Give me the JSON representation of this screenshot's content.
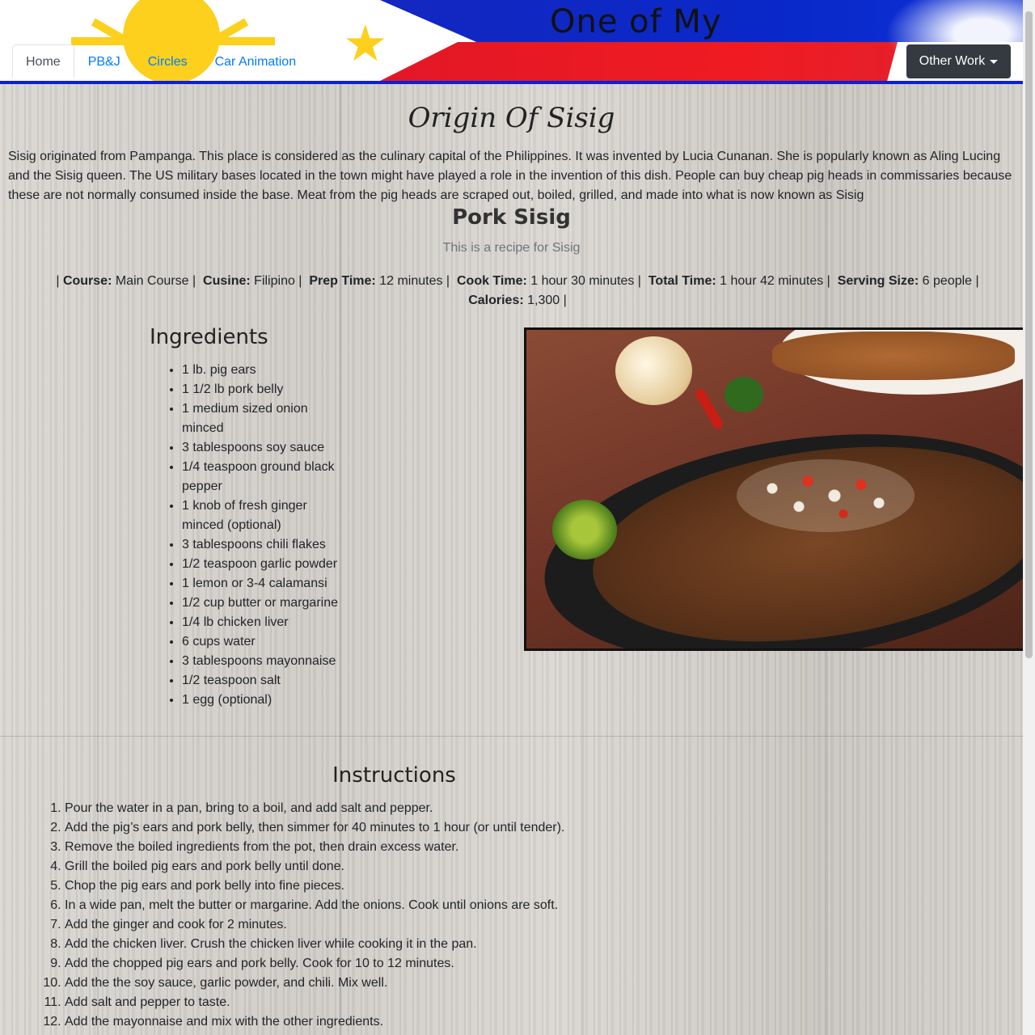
{
  "header": {
    "title": "One of My F",
    "nav_tabs": [
      {
        "label": "Home",
        "active": true
      },
      {
        "label": "PB&J",
        "active": false
      },
      {
        "label": "Circles",
        "active": false
      },
      {
        "label": "Car Animation",
        "active": false
      }
    ],
    "dropdown_label": "Other Work"
  },
  "origin": {
    "title": "Origin Of Sisig",
    "text": "Sisig originated from Pampanga. This place is considered as the culinary capital of the Philippines. It was invented by Lucia Cunanan. She is popularly known as Aling Lucing and the Sisig queen. The US military bases located in the town might have played a role in the invention of this dish. People can buy cheap pig heads in commissaries because these are not normally consumed inside the base. Meat from the pig heads are scraped out, boiled, grilled, and made into what is now known as Sisig"
  },
  "recipe": {
    "title": "Pork Sisig",
    "subtitle": "This is a recipe for Sisig",
    "meta": [
      {
        "label": "Course:",
        "value": "Main Course"
      },
      {
        "label": "Cusine:",
        "value": "Filipino"
      },
      {
        "label": "Prep Time:",
        "value": "12 minutes"
      },
      {
        "label": "Cook Time:",
        "value": "1 hour 30 minutes"
      },
      {
        "label": "Total Time:",
        "value": "1 hour 42 minutes"
      },
      {
        "label": "Serving Size:",
        "value": "6 people"
      },
      {
        "label": "Calories:",
        "value": "1,300"
      }
    ],
    "ingredients_title": "Ingredients",
    "ingredients": [
      "1 lb. pig ears",
      "1 1/2 lb pork belly",
      "1 medium sized onion minced",
      "3 tablespoons soy sauce",
      "1/4 teaspoon ground black pepper",
      "1 knob of fresh ginger minced (optional)",
      "3 tablespoons chili flakes",
      "1/2 teaspoon garlic powder",
      "1 lemon or 3-4 calamansi",
      "1/2 cup butter or margarine",
      "1/4 lb chicken liver",
      "6 cups water",
      "3 tablespoons mayonnaise",
      "1/2 teaspoon salt",
      "1 egg (optional)"
    ],
    "instructions_title": "Instructions",
    "instructions": [
      "Pour the water in a pan, bring to a boil, and add salt and pepper.",
      "Add the pig’s ears and pork belly, then simmer for 40 minutes to 1 hour (or until tender).",
      "Remove the boiled ingredients from the pot, then drain excess water.",
      "Grill the boiled pig ears and pork belly until done.",
      "Chop the pig ears and pork belly into fine pieces.",
      "In a wide pan, melt the butter or margarine. Add the onions. Cook until onions are soft.",
      "Add the ginger and cook for 2 minutes.",
      "Add the chicken liver. Crush the chicken liver while cooking it in the pan.",
      "Add the chopped pig ears and pork belly. Cook for 10 to 12 minutes.",
      "Add the the soy sauce, garlic powder, and chili. Mix well.",
      "Add salt and pepper to taste.",
      "Add the mayonnaise and mix with the other ingredients."
    ]
  },
  "colors": {
    "flag_blue": "#0d1fd6",
    "flag_red": "#e21726",
    "sun_yellow": "#fcd01c",
    "link": "#007bff",
    "dark_button": "#343a40"
  }
}
